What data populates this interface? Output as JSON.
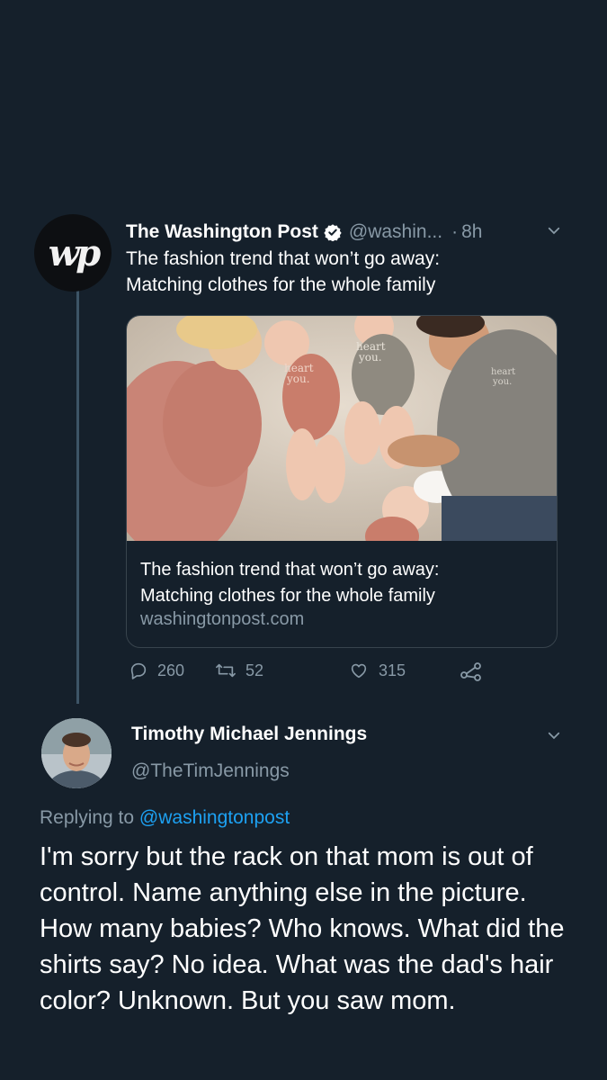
{
  "original_tweet": {
    "avatar_logo": "wp",
    "display_name": "The Washington Post",
    "verified_icon": "verified-badge-icon",
    "handle": "@washin...",
    "separator": "·",
    "time": "8h",
    "text_line1": "The fashion trend that won’t go away:",
    "text_line2": "Matching clothes for the whole family",
    "card": {
      "title_line1": "The fashion trend that won’t go away:",
      "title_line2": "Matching clothes for the whole family",
      "domain": "washingtonpost.com",
      "shirt_text_1": "heart",
      "shirt_text_2": "you."
    },
    "actions": {
      "replies": "260",
      "retweets": "52",
      "likes": "315"
    }
  },
  "reply": {
    "display_name": "Timothy Michael Jennings",
    "handle": "@TheTimJennings",
    "replying_to_label": "Replying to",
    "replying_to_mention": "@washingtonpost",
    "text": "I'm sorry but the rack on that mom is out of control. Name anything else in the picture. How many babies? Who knows. What did the shirts say? No idea. What was the dad's hair color? Unknown. But you saw mom."
  },
  "colors": {
    "background": "#15202b",
    "secondary_text": "#8899a6",
    "link": "#1da1f2",
    "border": "#38444d"
  }
}
